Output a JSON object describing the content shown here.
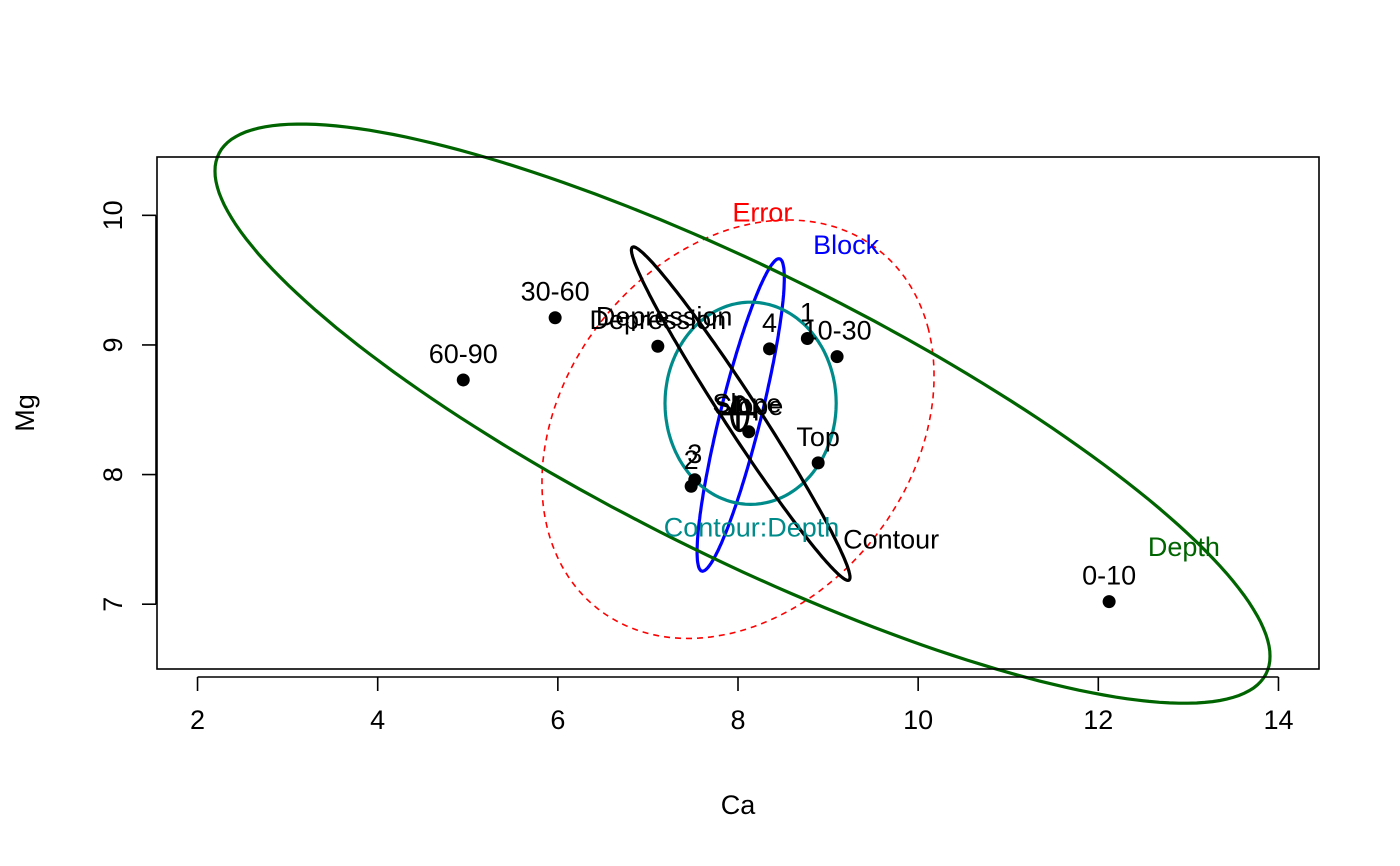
{
  "chart_data": {
    "type": "scatter",
    "title": "",
    "xlabel": "Ca",
    "ylabel": "Mg",
    "xlim": [
      1.55,
      14.45
    ],
    "ylim": [
      6.5,
      10.45
    ],
    "x_ticks": [
      "2",
      "4",
      "6",
      "8",
      "10",
      "12",
      "14"
    ],
    "y_ticks": [
      "7",
      "8",
      "9",
      "10"
    ],
    "points": [
      {
        "label": "60-90",
        "x": 4.95,
        "y": 8.73
      },
      {
        "label": "30-60",
        "x": 5.97,
        "y": 9.21
      },
      {
        "label": "Depression",
        "x": 7.11,
        "y": 8.99
      },
      {
        "label": "4",
        "x": 8.35,
        "y": 8.97
      },
      {
        "label": "1",
        "x": 8.77,
        "y": 9.05
      },
      {
        "label": "10-30",
        "x": 9.1,
        "y": 8.91
      },
      {
        "label": "Slope",
        "x": 8.12,
        "y": 8.33
      },
      {
        "label": "Top",
        "x": 8.89,
        "y": 8.09
      },
      {
        "label": "3",
        "x": 7.52,
        "y": 7.96
      },
      {
        "label": "2",
        "x": 7.48,
        "y": 7.91
      },
      {
        "label": "0-10",
        "x": 12.12,
        "y": 7.02
      }
    ],
    "center": {
      "x": 8.0,
      "y": 8.47
    },
    "ellipses": [
      {
        "name": "Error",
        "color": "#FF0000",
        "style": "dashed",
        "center": [
          8.0,
          8.35
        ],
        "semi_axes": [
          2.25,
          1.51
        ],
        "angle_deg": 20
      },
      {
        "name": "Block",
        "color": "#0000FF",
        "style": "solid",
        "center": [
          8.03,
          8.46
        ],
        "semi_axes": [
          1.28,
          0.22
        ],
        "angle_deg": 70
      },
      {
        "name": "Depth",
        "color": "#006400",
        "style": "solid",
        "center": [
          8.05,
          8.47
        ],
        "semi_axes": [
          6.16,
          1.16
        ],
        "angle_deg": -18.4
      },
      {
        "name": "Contour:Depth",
        "color": "#008B8B",
        "style": "solid",
        "center": [
          8.14,
          8.55
        ],
        "semi_axes": [
          0.95,
          0.78
        ],
        "angle_deg": 0
      },
      {
        "name": "Contour",
        "color": "#000000",
        "style": "solid",
        "center": [
          8.03,
          8.47
        ],
        "semi_axes": [
          1.76,
          0.17
        ],
        "angle_deg": -46.7
      },
      {
        "name": "Slope",
        "color": "#000000",
        "style": "solid",
        "center": [
          8.02,
          8.47
        ],
        "semi_axes": [
          0.09,
          0.13
        ],
        "angle_deg": 0
      }
    ],
    "ellipse_labels": [
      {
        "text": "Error",
        "color": "#FF0000",
        "x": 8.27,
        "y": 10.02
      },
      {
        "text": "Block",
        "color": "#0000FF",
        "x": 9.2,
        "y": 9.77
      },
      {
        "text": "Depression",
        "color": "#000000",
        "x": 7.18,
        "y": 9.22
      },
      {
        "text": "Slope",
        "color": "#000000",
        "x": 8.1,
        "y": 8.55
      },
      {
        "text": "Contour:Depth",
        "color": "#008B8B",
        "x": 8.15,
        "y": 7.59
      },
      {
        "text": "Contour",
        "color": "#000000",
        "x": 9.7,
        "y": 7.5
      },
      {
        "text": "Depth",
        "color": "#006400",
        "x": 12.95,
        "y": 7.44
      }
    ],
    "grid": false,
    "legend": "none"
  }
}
